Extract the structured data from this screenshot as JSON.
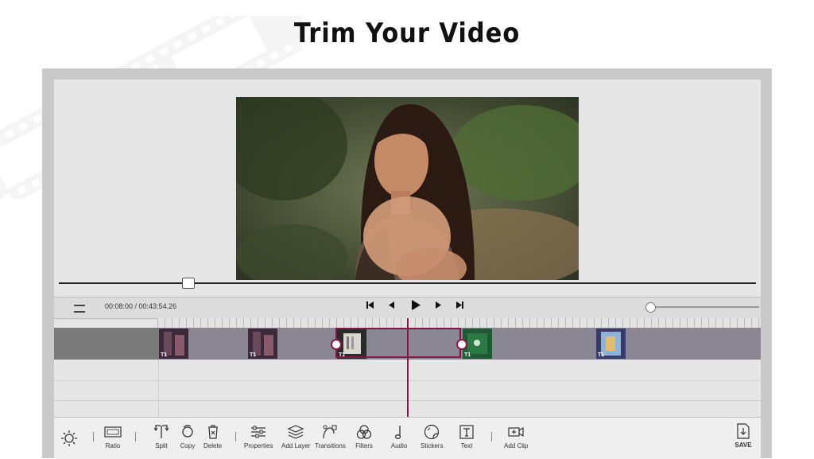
{
  "page": {
    "title": "Trim Your Video"
  },
  "player": {
    "timecode": "00:08:00 / 00:43:54.26",
    "scrub_progress": 0.19,
    "zoom_level": 0.0
  },
  "timeline": {
    "clips": [
      {
        "label": "T1"
      },
      {
        "label": "T1"
      },
      {
        "label": "T1"
      },
      {
        "label": "T1"
      },
      {
        "label": "T1"
      }
    ]
  },
  "toolbar": {
    "ratio": "Ratio",
    "split": "Split",
    "copy": "Copy",
    "delete": "Delete",
    "properties": "Properties",
    "add_layer": "Add Layer",
    "transitions": "Transitions",
    "filters": "Filters",
    "audio": "Audio",
    "stickers": "Stickers",
    "text": "Text",
    "add_clip": "Add Clip",
    "save": "SAVE"
  },
  "colors": {
    "accent": "#8a1545",
    "track": "#8a8693"
  }
}
